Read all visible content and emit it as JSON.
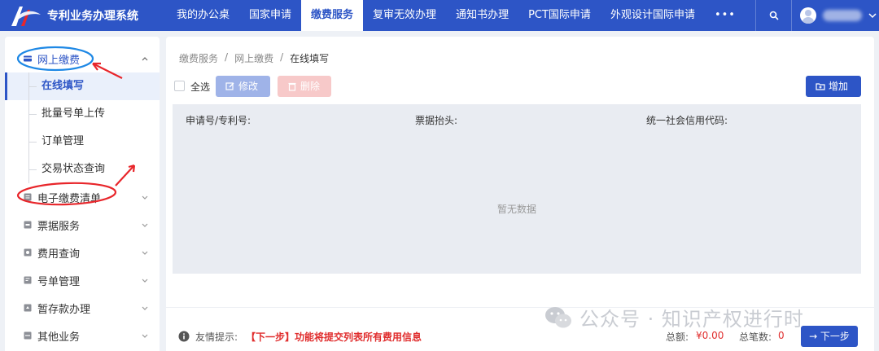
{
  "app": {
    "title": "专利业务办理系统"
  },
  "nav": {
    "items": [
      {
        "label": "我的办公桌",
        "active": false
      },
      {
        "label": "国家申请",
        "active": false
      },
      {
        "label": "缴费服务",
        "active": true
      },
      {
        "label": "复审无效办理",
        "active": false
      },
      {
        "label": "通知书办理",
        "active": false
      },
      {
        "label": "PCT国际申请",
        "active": false
      },
      {
        "label": "外观设计国际申请",
        "active": false
      }
    ],
    "more_label": "•••"
  },
  "sidebar": {
    "groups": [
      {
        "label": "网上缴费",
        "icon": "card-icon",
        "open": true,
        "items": [
          {
            "label": "在线填写",
            "active": true
          },
          {
            "label": "批量号单上传",
            "active": false
          },
          {
            "label": "订单管理",
            "active": false
          },
          {
            "label": "交易状态查询",
            "active": false
          }
        ]
      },
      {
        "label": "电子缴费清单",
        "icon": "list-icon",
        "open": false
      },
      {
        "label": "票据服务",
        "icon": "receipt-icon",
        "open": false
      },
      {
        "label": "费用查询",
        "icon": "query-icon",
        "open": false
      },
      {
        "label": "号单管理",
        "icon": "doc-icon",
        "open": false
      },
      {
        "label": "暂存款办理",
        "icon": "deposit-icon",
        "open": false
      },
      {
        "label": "其他业务",
        "icon": "other-icon",
        "open": false
      }
    ]
  },
  "breadcrumb": {
    "items": [
      "缴费服务",
      "网上缴费",
      "在线填写"
    ],
    "separator": "/"
  },
  "toolbar": {
    "select_all": "全选",
    "edit": "修改",
    "delete": "删除",
    "add": "增加"
  },
  "table": {
    "headers": [
      "申请号/专利号:",
      "票据抬头:",
      "统一社会信用代码:"
    ],
    "empty_text": "暂无数据"
  },
  "footer": {
    "tip_label": "友情提示:",
    "tip_text": "【下一步】功能将提交列表所有费用信息",
    "total_label": "总额:",
    "total_value": "¥0.00",
    "count_label": "总笔数:",
    "count_value": "0",
    "next_button": "→ 下一步"
  },
  "watermark": {
    "text": "公众号 · 知识产权进行时"
  },
  "colors": {
    "primary": "#2d55c6",
    "danger": "#e02e2e",
    "annotation_blue": "#1e88e5",
    "annotation_red": "#e8262b"
  }
}
